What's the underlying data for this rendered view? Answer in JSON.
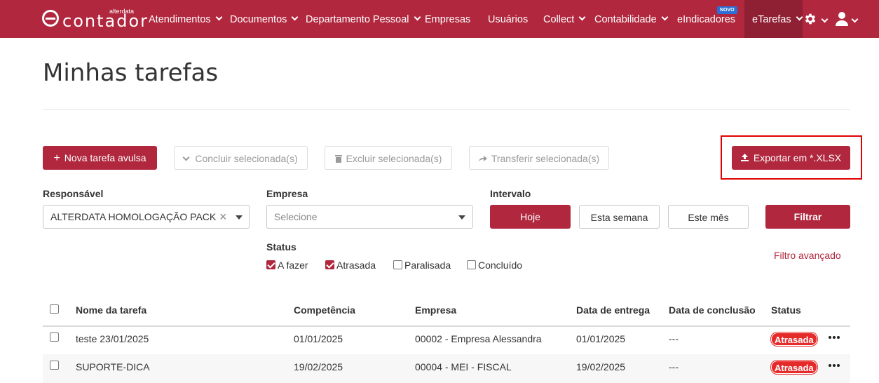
{
  "navbar": {
    "logo_text": "contador",
    "logo_brand": "alterdata",
    "items": [
      {
        "label": "Atendimentos",
        "dropdown": true
      },
      {
        "label": "Documentos",
        "dropdown": true
      },
      {
        "label": "Departamento Pessoal",
        "dropdown": true
      },
      {
        "label": "Empresas",
        "dropdown": false
      },
      {
        "label": "Usuários",
        "dropdown": false
      },
      {
        "label": "Collect",
        "dropdown": true
      },
      {
        "label": "Contabilidade",
        "dropdown": true
      },
      {
        "label": "eIndicadores",
        "dropdown": false,
        "badge": "NOVO"
      },
      {
        "label": "eTarefas",
        "dropdown": true,
        "active": true
      }
    ],
    "settings_icon": "gear-icon",
    "user_icon": "user-icon"
  },
  "page": {
    "title": "Minhas tarefas"
  },
  "toolbar": {
    "new_task": "Nova tarefa avulsa",
    "complete_selected": "Concluir selecionada(s)",
    "delete_selected": "Excluir selecionada(s)",
    "transfer_selected": "Transferir selecionada(s)",
    "export": "Exportar em *.XLSX"
  },
  "filters": {
    "responsavel_label": "Responsável",
    "responsavel_value": "ALTERDATA HOMOLOGAÇÃO PACK",
    "empresa_label": "Empresa",
    "empresa_placeholder": "Selecione",
    "intervalo_label": "Intervalo",
    "intervalo_options": [
      "Hoje",
      "Esta semana",
      "Este mês"
    ],
    "intervalo_selected": "Hoje",
    "filter_button": "Filtrar",
    "status_label": "Status",
    "status_options": [
      {
        "label": "A fazer",
        "checked": true
      },
      {
        "label": "Atrasada",
        "checked": true
      },
      {
        "label": "Paralisada",
        "checked": false
      },
      {
        "label": "Concluído",
        "checked": false
      }
    ],
    "advanced_filter": "Filtro avançado"
  },
  "table": {
    "columns": [
      "Nome da tarefa",
      "Competência",
      "Empresa",
      "Data de entrega",
      "Data de conclusão",
      "Status"
    ],
    "rows": [
      {
        "name": "teste 23/01/2025",
        "competencia": "01/01/2025",
        "empresa": "00002 - Empresa Alessandra",
        "entrega": "01/01/2025",
        "conclusao": "---",
        "status": "Atrasada"
      },
      {
        "name": "SUPORTE-DICA",
        "competencia": "19/02/2025",
        "empresa": "00004 - MEI - FISCAL",
        "entrega": "19/02/2025",
        "conclusao": "---",
        "status": "Atrasada"
      }
    ]
  },
  "colors": {
    "brand": "#b0273e",
    "status_late": "#e52a2a",
    "highlight": "#e00000"
  }
}
